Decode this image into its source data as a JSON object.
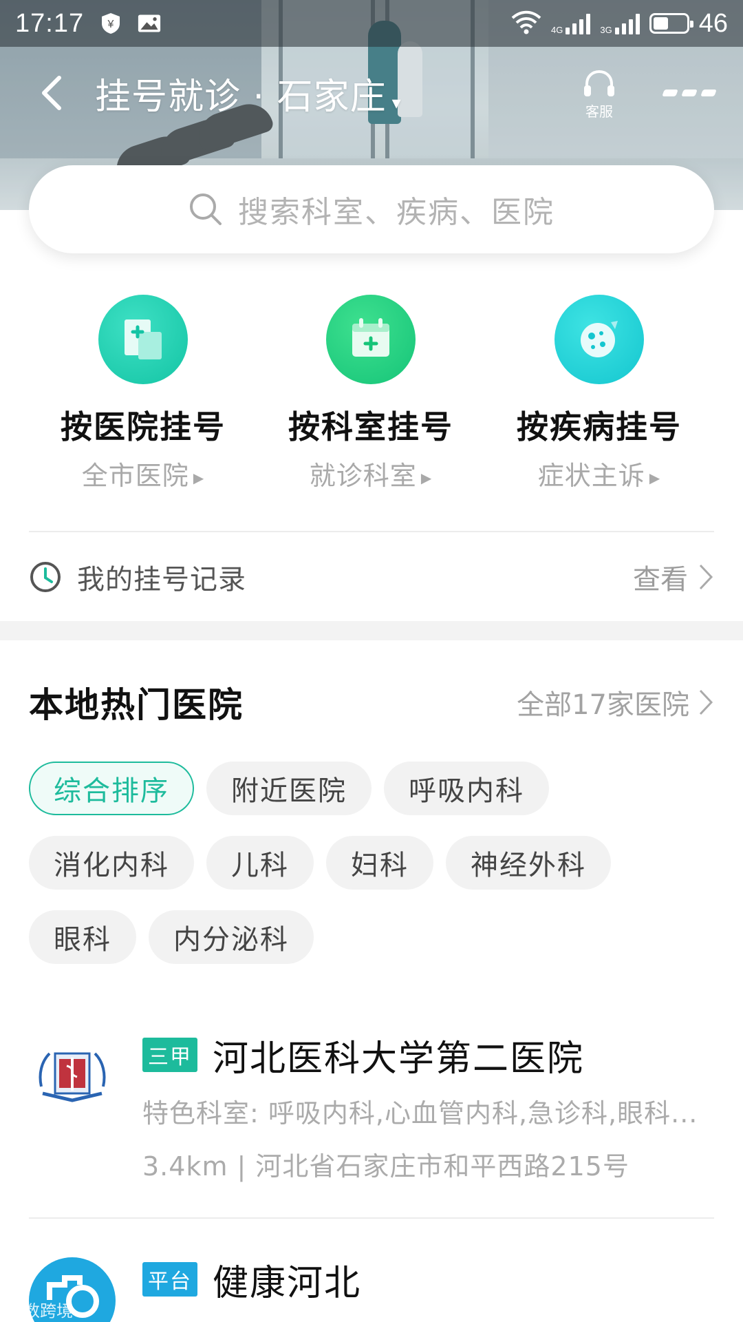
{
  "status_bar": {
    "time": "17:17",
    "network_1": "4G",
    "network_2": "3G",
    "battery_level": "46"
  },
  "nav": {
    "title": "挂号就诊 · 石家庄",
    "caret": "▾",
    "service_label": "客服"
  },
  "search": {
    "placeholder": "搜索科室、疾病、医院"
  },
  "quick_entries": [
    {
      "title": "按医院挂号",
      "subtitle": "全市医院",
      "icon": "hospital-document-icon"
    },
    {
      "title": "按科室挂号",
      "subtitle": "就诊科室",
      "icon": "calendar-plus-icon"
    },
    {
      "title": "按疾病挂号",
      "subtitle": "症状主诉",
      "icon": "virus-icon"
    }
  ],
  "records": {
    "label": "我的挂号记录",
    "action": "查看"
  },
  "hot_hospitals": {
    "heading": "本地热门医院",
    "all_link": "全部17家医院",
    "filters": [
      "综合排序",
      "附近医院",
      "呼吸内科",
      "消化内科",
      "儿科",
      "妇科",
      "神经外科",
      "眼科",
      "内分泌科"
    ],
    "active_filter_index": 0,
    "list": [
      {
        "tag": "三甲",
        "name": "河北医科大学第二医院",
        "departments": "特色科室: 呼吸内科,心血管内科,急诊科,眼科...",
        "distance_address": "3.4km | 河北省石家庄市和平西路215号"
      },
      {
        "tag": "平台",
        "name": "健康河北"
      }
    ]
  },
  "colors": {
    "accent": "#1dbb9c",
    "tag_blue": "#1fa8e0"
  },
  "watermark": "大数跨境"
}
